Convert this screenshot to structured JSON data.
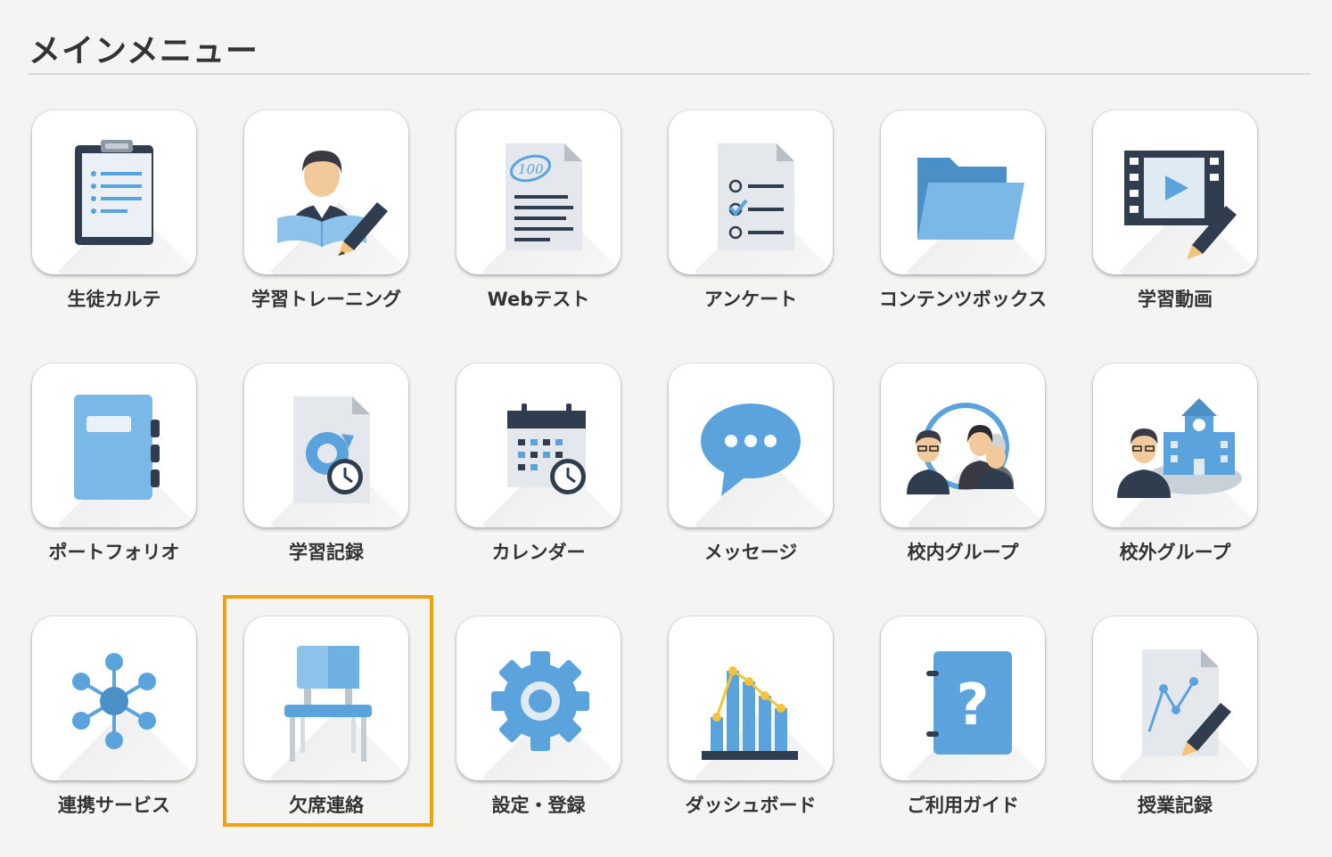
{
  "page": {
    "title": "メインメニュー"
  },
  "highlight_color": "#f0a00a",
  "menu": [
    {
      "label": "生徒カルテ",
      "icon": "clipboard-icon"
    },
    {
      "label": "学習トレーニング",
      "icon": "student-writing-icon"
    },
    {
      "label": "Webテスト",
      "icon": "test-paper-icon"
    },
    {
      "label": "アンケート",
      "icon": "survey-checklist-icon"
    },
    {
      "label": "コンテンツボックス",
      "icon": "folder-icon"
    },
    {
      "label": "学習動画",
      "icon": "video-edit-icon"
    },
    {
      "label": "ポートフォリオ",
      "icon": "notebook-icon"
    },
    {
      "label": "学習記録",
      "icon": "record-clock-icon"
    },
    {
      "label": "カレンダー",
      "icon": "calendar-icon"
    },
    {
      "label": "メッセージ",
      "icon": "chat-bubble-icon"
    },
    {
      "label": "校内グループ",
      "icon": "internal-group-icon"
    },
    {
      "label": "校外グループ",
      "icon": "external-group-icon"
    },
    {
      "label": "連携サービス",
      "icon": "network-hub-icon"
    },
    {
      "label": "欠席連絡",
      "icon": "chair-icon"
    },
    {
      "label": "設定・登録",
      "icon": "gear-icon"
    },
    {
      "label": "ダッシュボード",
      "icon": "bar-chart-icon"
    },
    {
      "label": "ご利用ガイド",
      "icon": "help-book-icon"
    },
    {
      "label": "授業記録",
      "icon": "lesson-chart-edit-icon"
    }
  ]
}
